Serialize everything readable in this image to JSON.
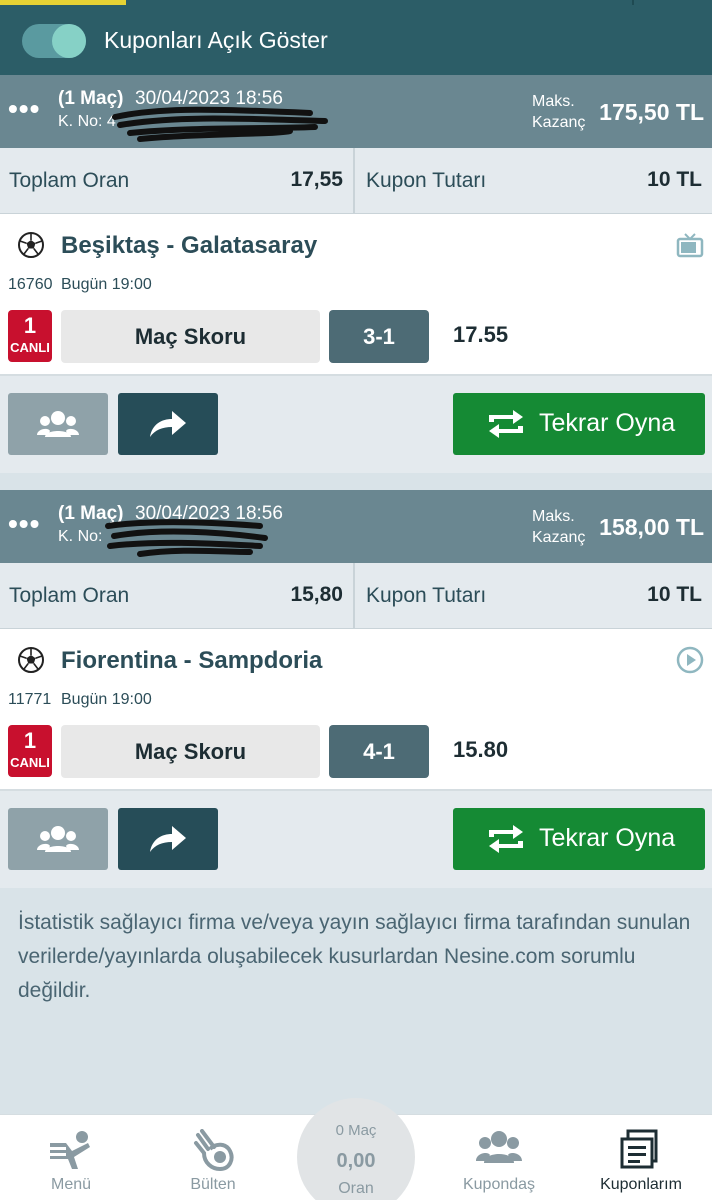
{
  "topbar": {
    "toggle_label": "Kuponları Açık Göster",
    "toggle_on": true
  },
  "coupons": [
    {
      "dots": "•••",
      "match_count": "(1 Maç)",
      "date": "30/04/2023 18:56",
      "kno": "K. No: 4",
      "maks_label_1": "Maks.",
      "maks_label_2": "Kazanç",
      "maks_value": "175,50 TL",
      "total_odd_label": "Toplam Oran",
      "total_odd_value": "17,55",
      "stake_label": "Kupon Tutarı",
      "stake_value": "10 TL",
      "match": {
        "teams": "Beşiktaş - Galatasaray",
        "code": "16760",
        "time": "Bugün 19:00",
        "live_num": "1",
        "live_label": "CANLI",
        "market": "Maç Skoru",
        "pick": "3-1",
        "odd": "17.55",
        "media_icon": "tv-icon"
      },
      "replay_label": "Tekrar Oyna"
    },
    {
      "dots": "•••",
      "match_count": "(1 Maç)",
      "date": "30/04/2023 18:56",
      "kno": "K. No:",
      "maks_label_1": "Maks.",
      "maks_label_2": "Kazanç",
      "maks_value": "158,00 TL",
      "total_odd_label": "Toplam Oran",
      "total_odd_value": "15,80",
      "stake_label": "Kupon Tutarı",
      "stake_value": "10 TL",
      "match": {
        "teams": "Fiorentina - Sampdoria",
        "code": "11771",
        "time": "Bugün 19:00",
        "live_num": "1",
        "live_label": "CANLI",
        "market": "Maç Skoru",
        "pick": "4-1",
        "odd": "15.80",
        "media_icon": "play-icon"
      },
      "replay_label": "Tekrar Oyna"
    }
  ],
  "disclaimer": "İstatistik sağlayıcı firma ve/veya yayın sağlayıcı firma tarafından sunulan verilerde/yayınlarda oluşabilecek kusurlardan Nesine.com sorumlu değildir.",
  "nav": {
    "menu": "Menü",
    "bulten": "Bülten",
    "center_mac": "0 Maç",
    "center_value": "0,00",
    "center_oran": "Oran",
    "kupondas": "Kupondaş",
    "kuponlarim": "Kuponlarım"
  },
  "colors": {
    "topbar": "#2c5d67",
    "header": "#6a8791",
    "replay_green": "#158a34",
    "live_red": "#c8102e",
    "accent": "#e7d234"
  }
}
